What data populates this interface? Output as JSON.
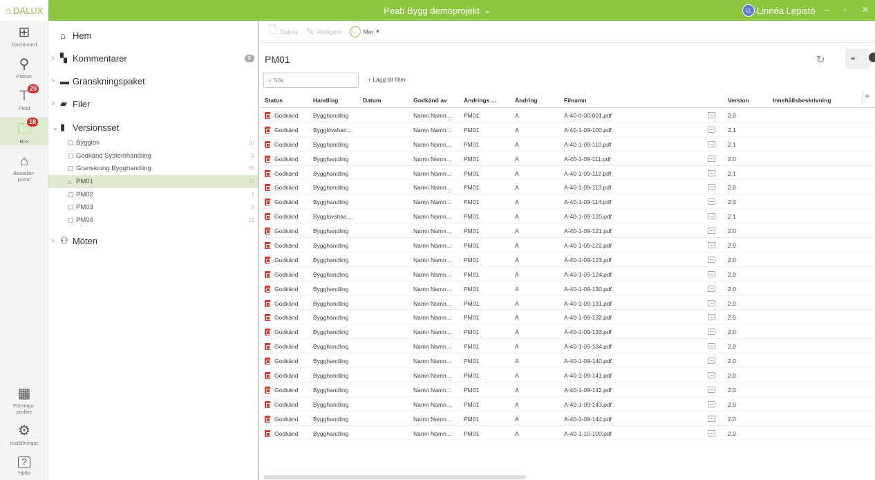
{
  "titlebar": {
    "logo": "DALUX",
    "project": "Peab Bygg demoprojekt",
    "project_chevron": "⌄",
    "user_initials": "LL",
    "user_name": "Linnéa Lepistö",
    "minimize": "–",
    "maximize": "▫",
    "close": "✕"
  },
  "rail": {
    "items": [
      {
        "label": "Dashboard",
        "icon": "dashboard-icon"
      },
      {
        "label": "Platser",
        "icon": "location-pin-icon"
      },
      {
        "label": "Field",
        "icon": "crane-icon",
        "badge": "20"
      },
      {
        "label": "Box",
        "icon": "folder-icon",
        "badge": "18"
      },
      {
        "label": "Beställar-\nportal",
        "icon": "client-portal-icon"
      },
      {
        "label": "Företags-\nprofiler",
        "icon": "building-icon"
      },
      {
        "label": "Inställningar",
        "icon": "gear-icon"
      },
      {
        "label": "Hjälp",
        "icon": "help-icon"
      }
    ]
  },
  "tree": {
    "home": "Hem",
    "comments": "Kommentarer",
    "comments_count": "9",
    "review_packages": "Granskningspaket",
    "files": "Filer",
    "version_sets": "Versionsset",
    "version_set_items": [
      {
        "label": "Bygglov",
        "count": "10"
      },
      {
        "label": "Godkänd Systemhandling",
        "count": "2"
      },
      {
        "label": "Granskning Bygghandling",
        "count": "76"
      },
      {
        "label": "PM01",
        "count": "23"
      },
      {
        "label": "PM02",
        "count": "1"
      },
      {
        "label": "PM03",
        "count": "6"
      },
      {
        "label": "PM04",
        "count": "18"
      }
    ],
    "meetings": "Möten"
  },
  "toolbar": {
    "open": "Öppna",
    "edit": "Redigera",
    "more": "Mer",
    "more_chevron": "▾"
  },
  "main": {
    "title": "PM01",
    "search_placeholder": "Sök",
    "add_filter": "+ Lägg till filter"
  },
  "table": {
    "columns": [
      "Status",
      "Handling",
      "Datum",
      "Godkänd av",
      "Ändrings ...",
      "Ändring",
      "Filnamn",
      "Version",
      "Innehållsbeskrivning"
    ],
    "rows": [
      [
        "Godkänd",
        "Bygghandling",
        "",
        "Namn Namn...",
        "PM01",
        "A",
        "A-40-0-00-001.pdf",
        "2.0"
      ],
      [
        "Godkänd",
        "Bygglovshan...",
        "",
        "Namn Namn...",
        "PM01",
        "A",
        "A-40-1-09-100.pdf",
        "2.1"
      ],
      [
        "Godkänd",
        "Bygghandling",
        "",
        "Namn Namn...",
        "PM01",
        "A",
        "A-40-1-09-110.pdf",
        "2.1"
      ],
      [
        "Godkänd",
        "Bygghandling",
        "",
        "Namn Namn...",
        "PM01",
        "A",
        "A-40-1-09-111.pdf",
        "2.0"
      ],
      [
        "Godkänd",
        "Bygghandling",
        "",
        "Namn Namn...",
        "PM01",
        "A",
        "A-40-1-09-112.pdf",
        "2.1"
      ],
      [
        "Godkänd",
        "Bygghandling",
        "",
        "Namn Namn...",
        "PM01",
        "A",
        "A-40-1-09-113.pdf",
        "2.0"
      ],
      [
        "Godkänd",
        "Bygghandling",
        "",
        "Namn Namn...",
        "PM01",
        "A",
        "A-40-1-09-114.pdf",
        "2.0"
      ],
      [
        "Godkänd",
        "Bygglovshan...",
        "",
        "Namn Namn...",
        "PM01",
        "A",
        "A-40-1-09-120.pdf",
        "2.1"
      ],
      [
        "Godkänd",
        "Bygghandling",
        "",
        "Namn Namn...",
        "PM01",
        "A",
        "A-40-1-09-121.pdf",
        "2.0"
      ],
      [
        "Godkänd",
        "Bygghandling",
        "",
        "Namn Namn...",
        "PM01",
        "A",
        "A-40-1-09-122.pdf",
        "2.0"
      ],
      [
        "Godkänd",
        "Bygghandling",
        "",
        "Namn Namn...",
        "PM01",
        "A",
        "A-40-1-09-123.pdf",
        "2.0"
      ],
      [
        "Godkänd",
        "Bygghandling",
        "",
        "Namn Namn...",
        "PM01",
        "A",
        "A-40-1-09-124.pdf",
        "2.0"
      ],
      [
        "Godkänd",
        "Bygghandling",
        "",
        "Namn Namn...",
        "PM01",
        "A",
        "A-40-1-09-130.pdf",
        "2.0"
      ],
      [
        "Godkänd",
        "Bygghandling",
        "",
        "Namn Namn...",
        "PM01",
        "A",
        "A-40-1-09-131.pdf",
        "2.0"
      ],
      [
        "Godkänd",
        "Bygghandling",
        "",
        "Namn Namn...",
        "PM01",
        "A",
        "A-40-1-09-132.pdf",
        "2.0"
      ],
      [
        "Godkänd",
        "Bygghandling",
        "",
        "Namn Namn...",
        "PM01",
        "A",
        "A-40-1-09-133.pdf",
        "2.0"
      ],
      [
        "Godkänd",
        "Bygghandling",
        "",
        "Namn Namn...",
        "PM01",
        "A",
        "A-40-1-09-134.pdf",
        "2.0"
      ],
      [
        "Godkänd",
        "Bygghandling",
        "",
        "Namn Namn...",
        "PM01",
        "A",
        "A-40-1-09-140.pdf",
        "2.0"
      ],
      [
        "Godkänd",
        "Bygghandling",
        "",
        "Namn Namn...",
        "PM01",
        "A",
        "A-40-1-09-141.pdf",
        "2.0"
      ],
      [
        "Godkänd",
        "Bygghandling",
        "",
        "Namn Namn...",
        "PM01",
        "A",
        "A-40-1-09-142.pdf",
        "2.0"
      ],
      [
        "Godkänd",
        "Bygghandling",
        "",
        "Namn Namn...",
        "PM01",
        "A",
        "A-40-1-09-143.pdf",
        "2.0"
      ],
      [
        "Godkänd",
        "Bygghandling",
        "",
        "Namn Namn...",
        "PM01",
        "A",
        "A-40-1-09-144.pdf",
        "2.0"
      ],
      [
        "Godkänd",
        "Bygghandling",
        "",
        "Namn Namn...",
        "PM01",
        "A",
        "A-40-1-10-100.pdf",
        "2.0"
      ]
    ]
  },
  "colors": {
    "brand_green": "#8dc63f",
    "selected_bg": "#dfe9cf",
    "badge_red": "#d32f2f",
    "pdf_red": "#d93a2b"
  }
}
